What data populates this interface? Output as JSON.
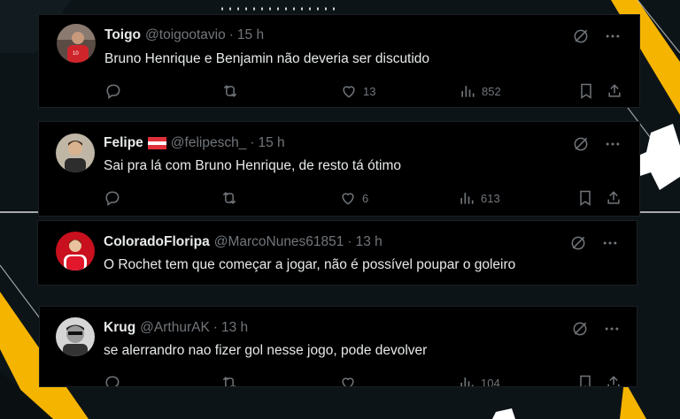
{
  "tweets": [
    {
      "name": "Toigo",
      "handle": "@toigootavio",
      "time": "15 h",
      "text": "Bruno Henrique e Benjamin não deveria ser discutido",
      "replies": "",
      "retweets": "",
      "likes": "13",
      "views": "852",
      "show_actions": true,
      "flag": false
    },
    {
      "name": "Felipe",
      "handle": "@felipesch_",
      "time": "15 h",
      "text": "Sai pra lá com Bruno Henrique, de resto tá ótimo",
      "replies": "",
      "retweets": "",
      "likes": "6",
      "views": "613",
      "show_actions": true,
      "flag": true
    },
    {
      "name": "ColoradoFloripa",
      "handle": "@MarcoNunes61851",
      "time": "13 h",
      "text": "O Rochet tem que começar a jogar, não é possível poupar o goleiro",
      "replies": "",
      "retweets": "",
      "likes": "",
      "views": "",
      "show_actions": false,
      "flag": false
    },
    {
      "name": "Krug",
      "handle": "@ArthurAK",
      "time": "13 h",
      "text": "se alerrandro nao fizer gol nesse jogo, pode devolver",
      "replies": "",
      "retweets": "",
      "likes": "",
      "views": "104",
      "show_actions": true,
      "flag": false
    }
  ],
  "separator": "·",
  "icons": {
    "grok": "grok-icon",
    "more": "more-icon",
    "reply": "reply-icon",
    "retweet": "retweet-icon",
    "like": "heart-icon",
    "views": "views-icon",
    "bookmark": "bookmark-icon",
    "share": "share-icon"
  },
  "colors": {
    "background": "#0d1418",
    "card": "#000000",
    "text": "#e7e9ea",
    "muted": "#71767b",
    "accent_yellow": "#f5b400",
    "flag_red": "#e0303a"
  }
}
